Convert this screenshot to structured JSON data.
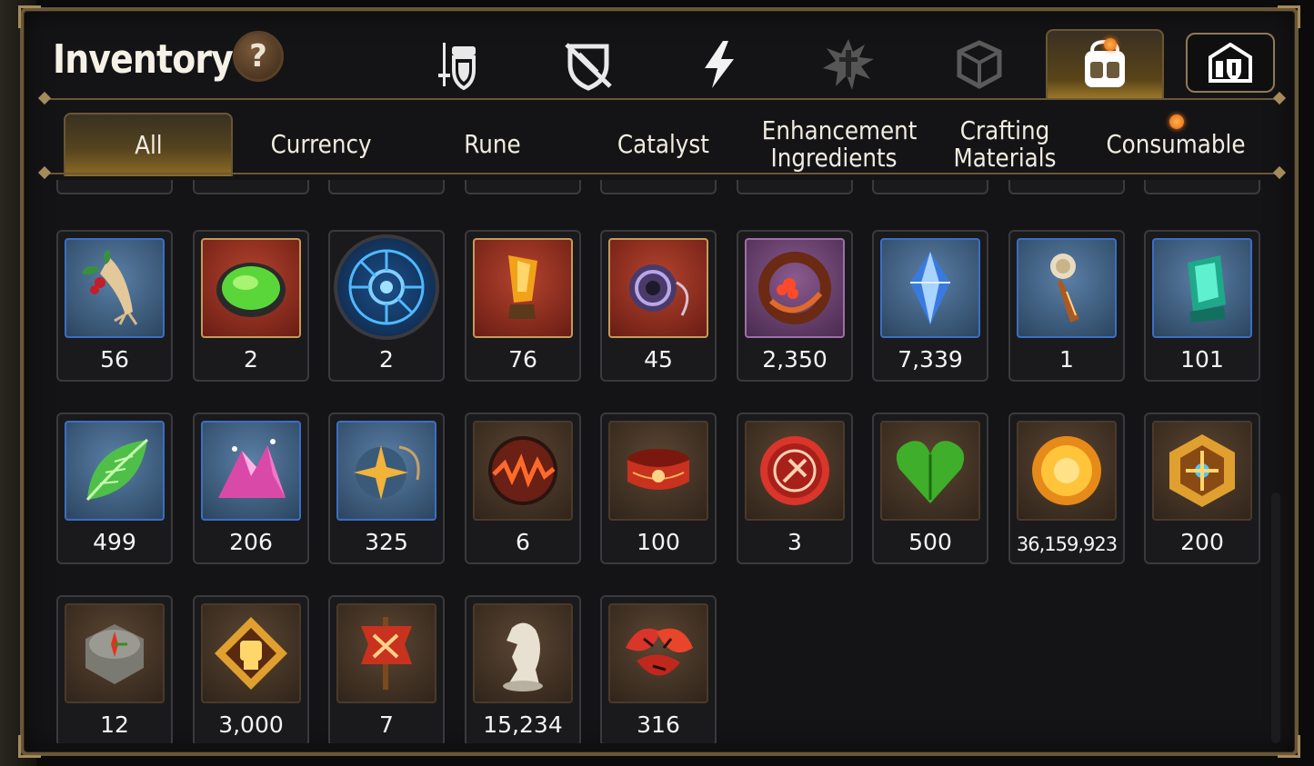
{
  "title": "Inventory",
  "help_label": "?",
  "top_tabs": [
    {
      "icon": "gear-sword-shield-icon"
    },
    {
      "icon": "shield-crossed-icon"
    },
    {
      "icon": "lightning-icon"
    },
    {
      "icon": "burst-sword-icon"
    },
    {
      "icon": "cube-icon"
    },
    {
      "icon": "backpack-icon",
      "active": true
    },
    {
      "icon": "guild-castle-icon"
    }
  ],
  "categories": [
    {
      "label": "All",
      "active": true
    },
    {
      "label": "Currency"
    },
    {
      "label": "Rune"
    },
    {
      "label": "Catalyst"
    },
    {
      "label": "Enhancement Ingredients"
    },
    {
      "label": "Crafting Materials"
    },
    {
      "label": "Consumable"
    }
  ],
  "items": [
    {
      "qty": "56",
      "icon": "ginseng-root-icon",
      "frame": "blue"
    },
    {
      "qty": "2",
      "icon": "green-gem-icon",
      "frame": "red"
    },
    {
      "qty": "2",
      "icon": "blue-rune-disc-icon",
      "frame": "round"
    },
    {
      "qty": "76",
      "icon": "amber-crystal-icon",
      "frame": "red"
    },
    {
      "qty": "45",
      "icon": "pendant-ring-icon",
      "frame": "red"
    },
    {
      "qty": "2,350",
      "icon": "red-flower-ring-icon",
      "frame": "purple"
    },
    {
      "qty": "7,339",
      "icon": "blue-crystal-icon",
      "frame": "blue"
    },
    {
      "qty": "1",
      "icon": "compass-pen-icon",
      "frame": "blue"
    },
    {
      "qty": "101",
      "icon": "teal-crystal-icon",
      "frame": "blue"
    },
    {
      "qty": "499",
      "icon": "green-leaf-icon",
      "frame": "blue"
    },
    {
      "qty": "206",
      "icon": "pink-ore-icon",
      "frame": "blue"
    },
    {
      "qty": "325",
      "icon": "star-amulet-icon",
      "frame": "blue"
    },
    {
      "qty": "6",
      "icon": "fire-orb-icon",
      "frame": "brown"
    },
    {
      "qty": "100",
      "icon": "red-bracelet-icon",
      "frame": "brown"
    },
    {
      "qty": "3",
      "icon": "red-seal-icon",
      "frame": "brown"
    },
    {
      "qty": "500",
      "icon": "green-heart-icon",
      "frame": "brown"
    },
    {
      "qty": "36,159,923",
      "icon": "gold-sun-coin-icon",
      "frame": "brown",
      "small": true
    },
    {
      "qty": "200",
      "icon": "gold-hex-emblem-icon",
      "frame": "brown"
    },
    {
      "qty": "12",
      "icon": "stone-compass-icon",
      "frame": "brown"
    },
    {
      "qty": "3,000",
      "icon": "fist-badge-icon",
      "frame": "brown"
    },
    {
      "qty": "7",
      "icon": "war-banner-icon",
      "frame": "brown"
    },
    {
      "qty": "15,234",
      "icon": "chess-knight-icon",
      "frame": "brown"
    },
    {
      "qty": "316",
      "icon": "red-leaves-icon",
      "frame": "brown"
    }
  ],
  "colors": {
    "accent_gold": "#a58a5a",
    "panel_bg": "#141416",
    "notification": "#ff7a1a"
  }
}
